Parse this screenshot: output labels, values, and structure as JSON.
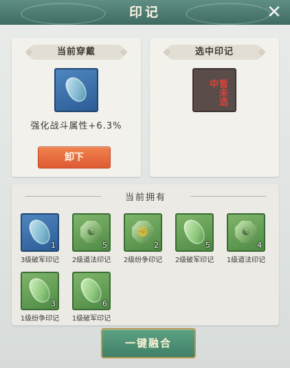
{
  "window": {
    "title": "印记",
    "close_icon": "close-icon"
  },
  "current_worn": {
    "header": "当前穿戴",
    "attribute_text": "强化战斗属性+6.3%",
    "unequip_label": "卸下"
  },
  "selected_mark": {
    "header": "选中印记",
    "placeholder_text": "暂未选中"
  },
  "owned": {
    "header": "当前拥有",
    "items": [
      {
        "name": "3级破军印记",
        "count": "1",
        "frame": "blue",
        "icon": "jade-stone-icon"
      },
      {
        "name": "2级道法印记",
        "count": "5",
        "frame": "green",
        "icon": "taiji-seal-icon"
      },
      {
        "name": "2级纷争印记",
        "count": "2",
        "frame": "green",
        "icon": "fist-seal-icon"
      },
      {
        "name": "2级破军印记",
        "count": "5",
        "frame": "green",
        "icon": "jade-stone-icon"
      },
      {
        "name": "1级道法印记",
        "count": "4",
        "frame": "green",
        "icon": "taiji-seal-icon"
      },
      {
        "name": "1级纷争印记",
        "count": "3",
        "frame": "green",
        "icon": "jade-stone-icon"
      },
      {
        "name": "1级破军印记",
        "count": "6",
        "frame": "green",
        "icon": "jade-stone-icon"
      }
    ]
  },
  "merge_button_label": "一键融合",
  "colors": {
    "title_bar": "#4d7b71",
    "unequip_button": "#e8693f",
    "merge_button": "#4e9076",
    "rare_frame": "#3b6ea8",
    "common_frame": "#5f9a51"
  }
}
